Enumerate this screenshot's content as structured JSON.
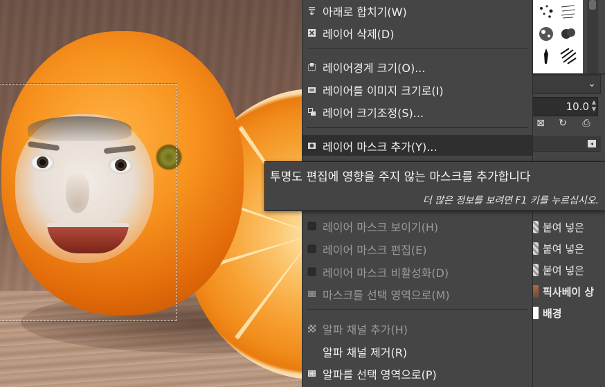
{
  "menu": {
    "items": [
      {
        "label": "아래로 합치기(W)",
        "icon": "merge-down-icon",
        "disabled": false
      },
      {
        "label": "레이어 삭제(D)",
        "icon": "delete-layer-icon",
        "disabled": false
      },
      {
        "label": "레이어경계 크기(O)...",
        "icon": "layer-boundary-size-icon",
        "disabled": false
      },
      {
        "label": "레이어를 이미지 크기로(I)",
        "icon": "layer-to-image-size-icon",
        "disabled": false
      },
      {
        "label": "레이어 크기조정(S)...",
        "icon": "scale-layer-icon",
        "disabled": false
      },
      {
        "label": "레이어 마스크 추가(Y)...",
        "icon": "add-layer-mask-icon",
        "disabled": false,
        "highlighted": true
      },
      {
        "label": "레이어 마스크 보이기(H)",
        "icon": "checkbox-icon",
        "disabled": true
      },
      {
        "label": "레이어 마스크 편집(E)",
        "icon": "checkbox-icon",
        "disabled": true
      },
      {
        "label": "레이어 마스크 비활성화(D)",
        "icon": "checkbox-icon",
        "disabled": true
      },
      {
        "label": "마스크를 선택 영역으로(M)",
        "icon": "mask-to-selection-icon",
        "disabled": true
      },
      {
        "label": "알파 채널 추가(H)",
        "icon": "add-alpha-channel-icon",
        "disabled": true
      },
      {
        "label": "알파 채널 제거(R)",
        "icon": "",
        "disabled": false
      },
      {
        "label": "알파를 선택 영역으로(P)",
        "icon": "alpha-to-selection-icon",
        "disabled": false
      }
    ]
  },
  "tooltip": {
    "main": "투명도 편집에 영향을 주지 않는 마스크를 추가합니다",
    "hint": "더 많은 정보를 보려면 F1 키를 누르십시오."
  },
  "dock": {
    "spin_value": "10.0",
    "layers": [
      {
        "name": "붙여 넣은",
        "thumb": "checker"
      },
      {
        "name": "붙여 넣은",
        "thumb": "checker"
      },
      {
        "name": "붙여 넣은",
        "thumb": "checker"
      },
      {
        "name": "픽사베이 상",
        "thumb": "image"
      },
      {
        "name": "배경",
        "thumb": "white"
      }
    ]
  }
}
